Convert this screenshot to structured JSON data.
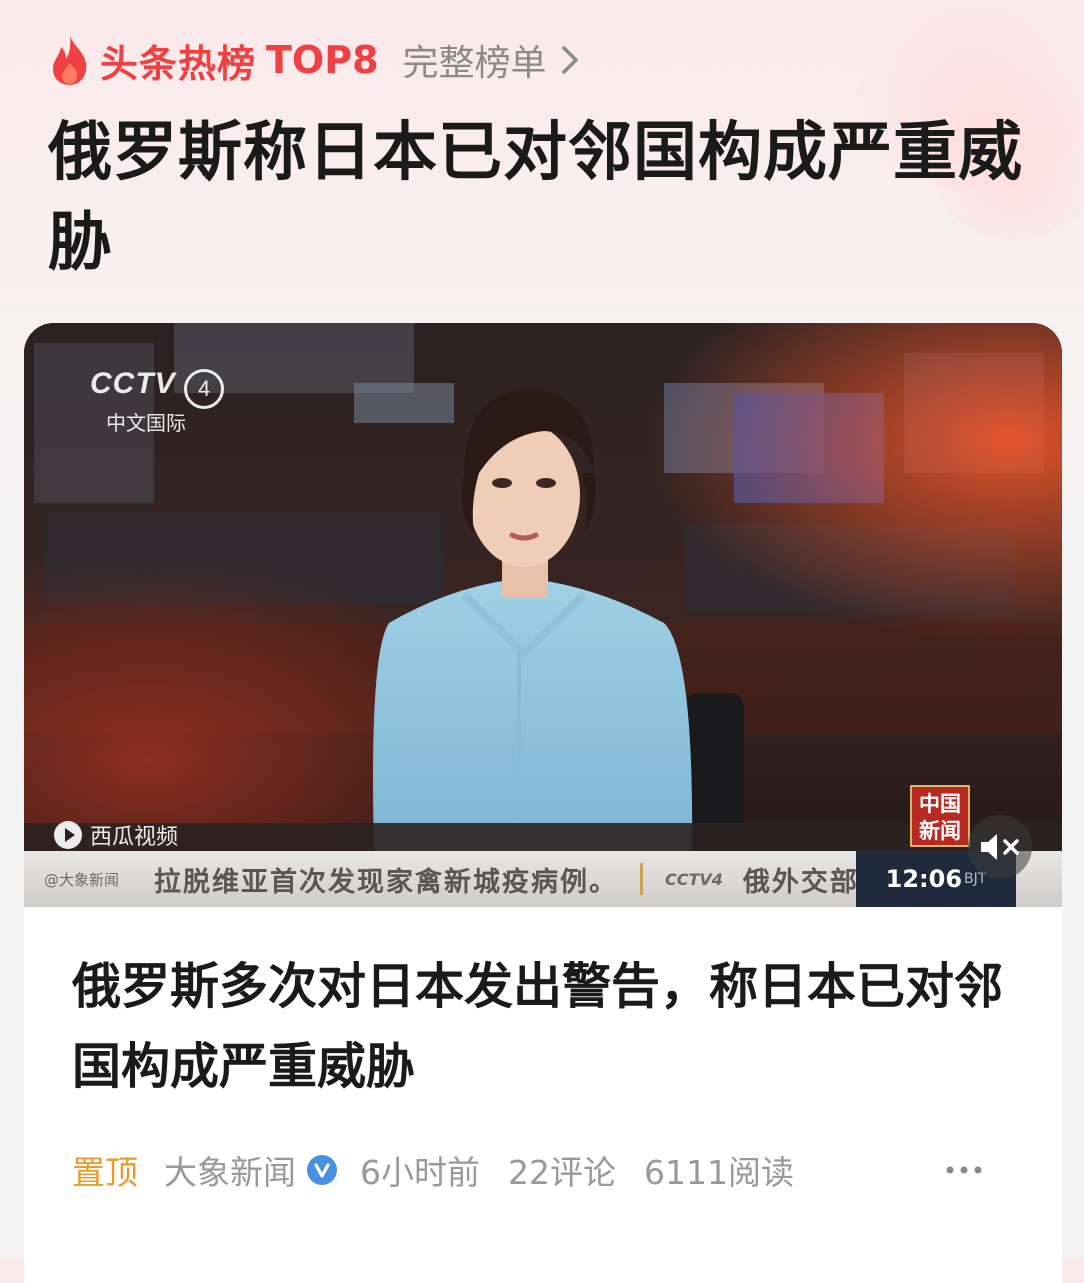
{
  "hot_list": {
    "title": "头条热榜",
    "rank": "TOP8",
    "full_list_label": "完整榜单"
  },
  "headline": "俄罗斯称日本已对邻国构成严重威胁",
  "video": {
    "channel_logo": "CCTV",
    "channel_number": "4",
    "channel_name": "中文国际",
    "watermark": "西瓜视频",
    "news_badge": "中国\n新闻",
    "ticker_source": "@大象新闻",
    "ticker_text": "拉脱维亚首次发现家禽新城疫病例。",
    "ticker_logo": "CCTV4",
    "ticker_text2": "俄外交部",
    "clock_time": "12:06",
    "clock_zone": "BJT"
  },
  "article": {
    "title": "俄罗斯多次对日本发出警告，称日本已对邻国构成严重威胁",
    "pin_label": "置顶",
    "source": "大象新闻",
    "time_ago": "6小时前",
    "comments": "22评论",
    "reads": "6111阅读"
  },
  "colors": {
    "accent_red": "#f04142",
    "pin_orange": "#e89b2a",
    "verified_blue": "#4a90e2",
    "muted_text": "#999999"
  },
  "icons": [
    "flame-icon",
    "chevron-right-icon",
    "mute-icon",
    "verified-icon",
    "more-icon"
  ]
}
